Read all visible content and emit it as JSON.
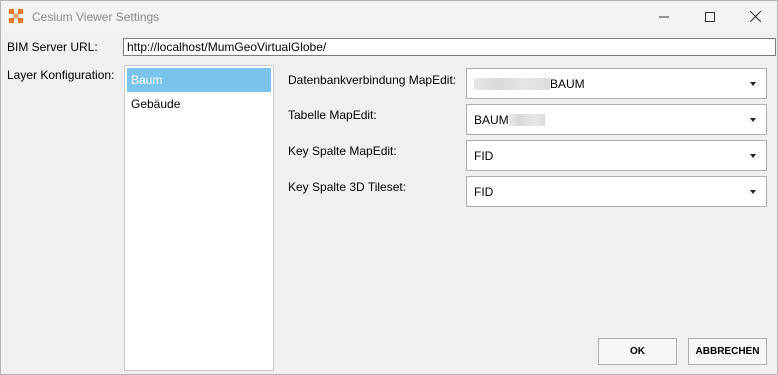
{
  "window": {
    "title": "Cesium Viewer Settings"
  },
  "fields": {
    "server_url_label": "BIM Server URL:",
    "server_url_value": "http://localhost/MumGeoVirtualGlobe/",
    "layer_config_label": "Layer Konfiguration:"
  },
  "layers": {
    "items": [
      {
        "label": "Baum",
        "selected": true
      },
      {
        "label": "Gebäude",
        "selected": false
      }
    ]
  },
  "settings": [
    {
      "label": "Datenbankverbindung MapEdit:",
      "value": "BAUM",
      "blurred_prefix": true
    },
    {
      "label": "Tabelle MapEdit:",
      "value": "BAUM",
      "blurred_suffix": true
    },
    {
      "label": "Key Spalte MapEdit:",
      "value": "FID"
    },
    {
      "label": "Key Spalte 3D Tileset:",
      "value": "FID"
    }
  ],
  "buttons": {
    "ok": "OK",
    "cancel": "ABBRECHEN"
  },
  "colors": {
    "selection": "#7ac4ec",
    "app_icon": "#e87722"
  }
}
